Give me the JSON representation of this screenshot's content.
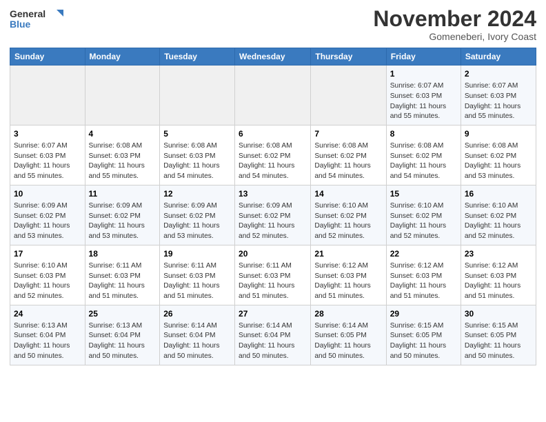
{
  "header": {
    "title": "November 2024",
    "location": "Gomeneberi, Ivory Coast"
  },
  "logo": {
    "line1": "General",
    "line2": "Blue"
  },
  "days_of_week": [
    "Sunday",
    "Monday",
    "Tuesday",
    "Wednesday",
    "Thursday",
    "Friday",
    "Saturday"
  ],
  "weeks": [
    [
      {
        "day": "",
        "info": ""
      },
      {
        "day": "",
        "info": ""
      },
      {
        "day": "",
        "info": ""
      },
      {
        "day": "",
        "info": ""
      },
      {
        "day": "",
        "info": ""
      },
      {
        "day": "1",
        "info": "Sunrise: 6:07 AM\nSunset: 6:03 PM\nDaylight: 11 hours\nand 55 minutes."
      },
      {
        "day": "2",
        "info": "Sunrise: 6:07 AM\nSunset: 6:03 PM\nDaylight: 11 hours\nand 55 minutes."
      }
    ],
    [
      {
        "day": "3",
        "info": "Sunrise: 6:07 AM\nSunset: 6:03 PM\nDaylight: 11 hours\nand 55 minutes."
      },
      {
        "day": "4",
        "info": "Sunrise: 6:08 AM\nSunset: 6:03 PM\nDaylight: 11 hours\nand 55 minutes."
      },
      {
        "day": "5",
        "info": "Sunrise: 6:08 AM\nSunset: 6:03 PM\nDaylight: 11 hours\nand 54 minutes."
      },
      {
        "day": "6",
        "info": "Sunrise: 6:08 AM\nSunset: 6:02 PM\nDaylight: 11 hours\nand 54 minutes."
      },
      {
        "day": "7",
        "info": "Sunrise: 6:08 AM\nSunset: 6:02 PM\nDaylight: 11 hours\nand 54 minutes."
      },
      {
        "day": "8",
        "info": "Sunrise: 6:08 AM\nSunset: 6:02 PM\nDaylight: 11 hours\nand 54 minutes."
      },
      {
        "day": "9",
        "info": "Sunrise: 6:08 AM\nSunset: 6:02 PM\nDaylight: 11 hours\nand 53 minutes."
      }
    ],
    [
      {
        "day": "10",
        "info": "Sunrise: 6:09 AM\nSunset: 6:02 PM\nDaylight: 11 hours\nand 53 minutes."
      },
      {
        "day": "11",
        "info": "Sunrise: 6:09 AM\nSunset: 6:02 PM\nDaylight: 11 hours\nand 53 minutes."
      },
      {
        "day": "12",
        "info": "Sunrise: 6:09 AM\nSunset: 6:02 PM\nDaylight: 11 hours\nand 53 minutes."
      },
      {
        "day": "13",
        "info": "Sunrise: 6:09 AM\nSunset: 6:02 PM\nDaylight: 11 hours\nand 52 minutes."
      },
      {
        "day": "14",
        "info": "Sunrise: 6:10 AM\nSunset: 6:02 PM\nDaylight: 11 hours\nand 52 minutes."
      },
      {
        "day": "15",
        "info": "Sunrise: 6:10 AM\nSunset: 6:02 PM\nDaylight: 11 hours\nand 52 minutes."
      },
      {
        "day": "16",
        "info": "Sunrise: 6:10 AM\nSunset: 6:02 PM\nDaylight: 11 hours\nand 52 minutes."
      }
    ],
    [
      {
        "day": "17",
        "info": "Sunrise: 6:10 AM\nSunset: 6:03 PM\nDaylight: 11 hours\nand 52 minutes."
      },
      {
        "day": "18",
        "info": "Sunrise: 6:11 AM\nSunset: 6:03 PM\nDaylight: 11 hours\nand 51 minutes."
      },
      {
        "day": "19",
        "info": "Sunrise: 6:11 AM\nSunset: 6:03 PM\nDaylight: 11 hours\nand 51 minutes."
      },
      {
        "day": "20",
        "info": "Sunrise: 6:11 AM\nSunset: 6:03 PM\nDaylight: 11 hours\nand 51 minutes."
      },
      {
        "day": "21",
        "info": "Sunrise: 6:12 AM\nSunset: 6:03 PM\nDaylight: 11 hours\nand 51 minutes."
      },
      {
        "day": "22",
        "info": "Sunrise: 6:12 AM\nSunset: 6:03 PM\nDaylight: 11 hours\nand 51 minutes."
      },
      {
        "day": "23",
        "info": "Sunrise: 6:12 AM\nSunset: 6:03 PM\nDaylight: 11 hours\nand 51 minutes."
      }
    ],
    [
      {
        "day": "24",
        "info": "Sunrise: 6:13 AM\nSunset: 6:04 PM\nDaylight: 11 hours\nand 50 minutes."
      },
      {
        "day": "25",
        "info": "Sunrise: 6:13 AM\nSunset: 6:04 PM\nDaylight: 11 hours\nand 50 minutes."
      },
      {
        "day": "26",
        "info": "Sunrise: 6:14 AM\nSunset: 6:04 PM\nDaylight: 11 hours\nand 50 minutes."
      },
      {
        "day": "27",
        "info": "Sunrise: 6:14 AM\nSunset: 6:04 PM\nDaylight: 11 hours\nand 50 minutes."
      },
      {
        "day": "28",
        "info": "Sunrise: 6:14 AM\nSunset: 6:05 PM\nDaylight: 11 hours\nand 50 minutes."
      },
      {
        "day": "29",
        "info": "Sunrise: 6:15 AM\nSunset: 6:05 PM\nDaylight: 11 hours\nand 50 minutes."
      },
      {
        "day": "30",
        "info": "Sunrise: 6:15 AM\nSunset: 6:05 PM\nDaylight: 11 hours\nand 50 minutes."
      }
    ]
  ]
}
